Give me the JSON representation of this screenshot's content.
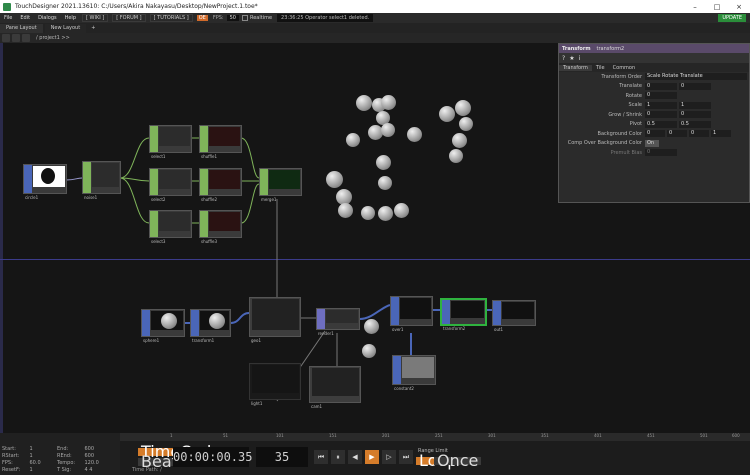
{
  "window": {
    "title": "TouchDesigner 2021.13610: C:/Users/Akira Nakayasu/Desktop/NewProject.1.toe*"
  },
  "menu": {
    "items": [
      "File",
      "Edit",
      "Dialogs",
      "Help"
    ],
    "wiki": "[ WIKI ]",
    "forum": "[ FORUM ]",
    "tutorials": "[ TUTORIALS ]",
    "oe": "OE",
    "fps_label": "FPS:",
    "fps_value": "50",
    "realtime": "Realtime",
    "status": "23:36:25 Operator select1 deleted.",
    "update": "UPDATE"
  },
  "tabs": {
    "items": [
      "Pane Layout",
      "New Layout"
    ],
    "plus": "+"
  },
  "path": {
    "text": "/ project1  >>"
  },
  "nodes": {
    "circle": "circle1",
    "noise": "noise1",
    "constant": "constant1",
    "select1": "select1",
    "select2": "select2",
    "select3": "select3",
    "shuffle1": "shuffle1",
    "shuffle2": "shuffle2",
    "shuffle3": "shuffle3",
    "merge1": "merge1",
    "sphere1": "sphere1",
    "transform1": "transform1",
    "geo1": "geo1",
    "render1": "render1",
    "over1": "over1",
    "transform2": "transform2",
    "out1": "out1",
    "light1": "light1",
    "cam1": "cam1",
    "constant2": "constant2"
  },
  "params": {
    "title": "Transform",
    "name": "transform2",
    "icons": [
      "?",
      "★",
      "i"
    ],
    "tabs": [
      "Transform",
      "Tile",
      "Common"
    ],
    "rows": [
      {
        "label": "Transform Order",
        "values": [
          "Scale Rotate Translate"
        ]
      },
      {
        "label": "Translate",
        "values": [
          "0",
          "0"
        ]
      },
      {
        "label": "Rotate",
        "values": [
          "0"
        ]
      },
      {
        "label": "Scale",
        "values": [
          "1",
          "1"
        ]
      },
      {
        "label": "Grow / Shrink",
        "values": [
          "0",
          "0"
        ]
      },
      {
        "label": "Pivot",
        "values": [
          "0.5",
          "0.5"
        ]
      },
      {
        "label": "Background Color",
        "values": [
          "0",
          "0",
          "0",
          "1"
        ]
      },
      {
        "label": "Comp Over Background Color",
        "values": [
          "On"
        ]
      },
      {
        "label": "Premult Bias",
        "values": [
          "0"
        ]
      }
    ]
  },
  "ruler": [
    "1",
    "51",
    "101",
    "151",
    "201",
    "251",
    "301",
    "351",
    "401",
    "451",
    "501",
    "551",
    "600"
  ],
  "stats": [
    [
      "Start:",
      "1",
      "End:",
      "600"
    ],
    [
      "RStart:",
      "1",
      "REnd:",
      "600"
    ],
    [
      "FPS:",
      "60.0",
      "Tempo:",
      "120.0"
    ],
    [
      "ResetF:",
      "1",
      "T Sig:",
      "4  4"
    ]
  ],
  "timecontrol": {
    "timecode_label": "TimeCode",
    "beats_label": "Beats",
    "timecode": "00:00:00.35",
    "frame": "35",
    "range_label": "Range Limit",
    "loop": "Loop",
    "once": "Once",
    "time_path": "Time Path: /"
  },
  "colors": {
    "chop": "#7fb45a",
    "top": "#4a66b8",
    "sop": "#6e6ec0",
    "accent": "#d57c2a",
    "update": "#2a8d3a"
  }
}
